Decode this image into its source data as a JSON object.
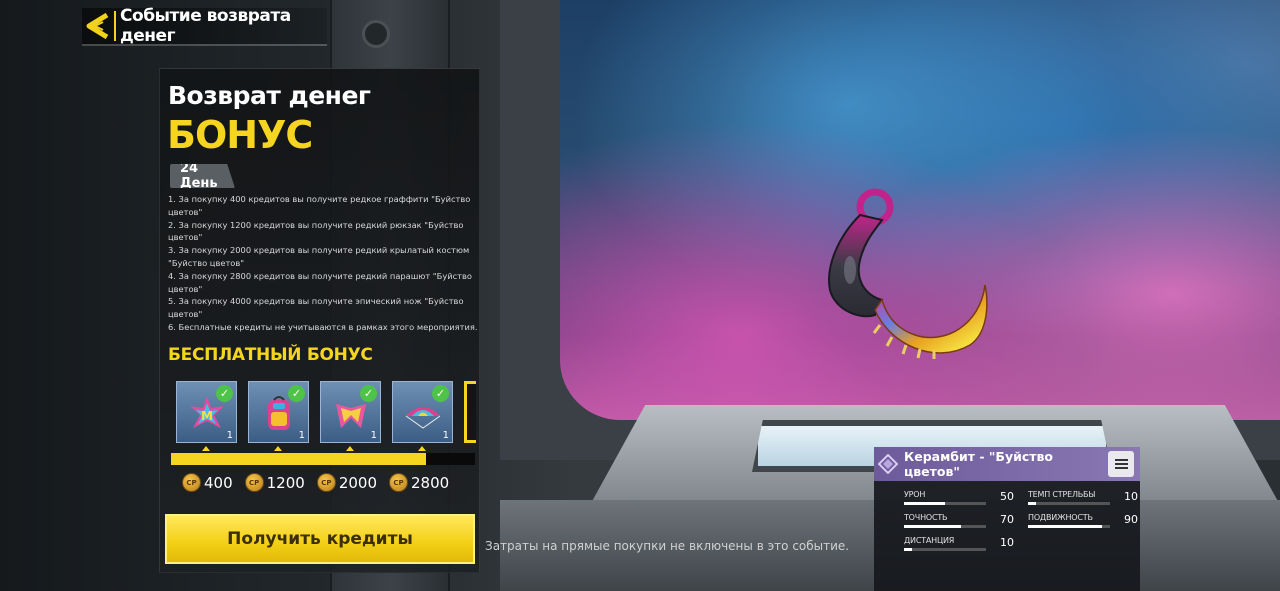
{
  "header": {
    "title": "Событие возврата денег"
  },
  "panel": {
    "title": "Возврат денег",
    "bonus": "БОНУС",
    "day": "24 День",
    "rules": [
      "1. За покупку 400 кредитов вы получите редкое граффити \"Буйство цветов\"",
      "2. За покупку 1200 кредитов вы получите редкий рюкзак \"Буйство цветов\"",
      "3. За покупку 2000 кредитов вы получите редкий крылатый костюм \"Буйство цветов\"",
      "4. За покупку 2800 кредитов вы получите редкий парашют \"Буйство цветов\"",
      "5. За покупку 4000 кредитов вы получите эпический нож \"Буйство цветов\"",
      "6. Бесплатные кредиты не учитываются в рамках этого мероприятия."
    ],
    "free_bonus_title": "БЕСПЛАТНЫЙ БОНУС",
    "rewards": [
      {
        "icon": "graffiti-icon",
        "count": "1",
        "claimed": true
      },
      {
        "icon": "backpack-icon",
        "count": "1",
        "claimed": true
      },
      {
        "icon": "wingsuit-icon",
        "count": "1",
        "claimed": true
      },
      {
        "icon": "parachute-icon",
        "count": "1",
        "claimed": true
      }
    ],
    "progress": 0.84,
    "currency_icon_text": "CP",
    "milestones": [
      "400",
      "1200",
      "2000",
      "2800"
    ],
    "button": "Получить кредиты"
  },
  "note": "Затраты на прямые покупки не включены в это событие.",
  "weapon_card": {
    "title": "Керамбит - \"Буйство цветов\"",
    "rarity_color": "#8a78b4",
    "stats": [
      {
        "label": "УРОН",
        "value": 50
      },
      {
        "label": "ТОЧНОСТЬ",
        "value": 70
      },
      {
        "label": "ДИСТАНЦИЯ",
        "value": 10
      },
      {
        "label": "ТЕМП СТРЕЛЬБЫ",
        "value": 10
      },
      {
        "label": "ПОДВИЖНОСТЬ",
        "value": 90
      }
    ]
  },
  "colors": {
    "accent": "#f5d520",
    "claimed": "#4fc24a"
  }
}
